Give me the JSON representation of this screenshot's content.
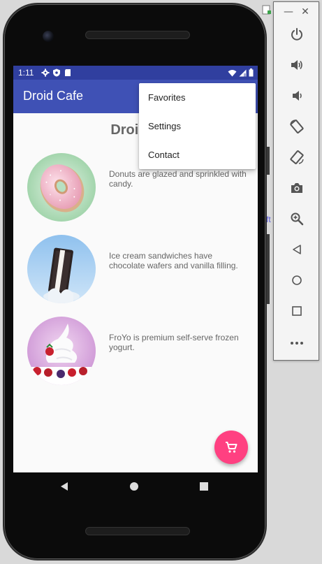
{
  "status_bar": {
    "time": "1:11",
    "left_icons": [
      "gear-icon",
      "shield-icon",
      "sd-card-icon"
    ],
    "right_icons": [
      "wifi-icon",
      "signal-icon",
      "battery-icon"
    ]
  },
  "app_bar": {
    "title": "Droid Cafe"
  },
  "page": {
    "heading": "Droid De"
  },
  "desserts": [
    {
      "name": "donut",
      "description": "Donuts are glazed and sprinkled with candy."
    },
    {
      "name": "ice-cream-sandwich",
      "description": "Ice cream sandwiches have chocolate wafers and vanilla filling."
    },
    {
      "name": "froyo",
      "description": "FroYo is premium self-serve frozen yogurt."
    }
  ],
  "overflow_menu": {
    "items": [
      {
        "label": "Favorites"
      },
      {
        "label": "Settings"
      },
      {
        "label": "Contact"
      }
    ]
  },
  "fab": {
    "icon": "cart-icon"
  },
  "nav_bar": {
    "buttons": [
      "back-icon",
      "home-icon",
      "recents-icon"
    ]
  },
  "emulator_toolbar": {
    "window_buttons": [
      "minimize-icon",
      "close-icon"
    ],
    "minimize_glyph": "—",
    "close_glyph": "✕",
    "tools": [
      "power-icon",
      "volume-up-icon",
      "volume-down-icon",
      "rotate-left-icon",
      "rotate-right-icon",
      "camera-icon",
      "zoom-icon",
      "back-icon",
      "home-icon",
      "overview-icon",
      "more-icon"
    ]
  },
  "background": {
    "fragment_text": "ft"
  },
  "colors": {
    "status_bar": "#303f9f",
    "app_bar": "#3f51b5",
    "fab": "#ff4081",
    "screen_bg": "#fafafa"
  }
}
